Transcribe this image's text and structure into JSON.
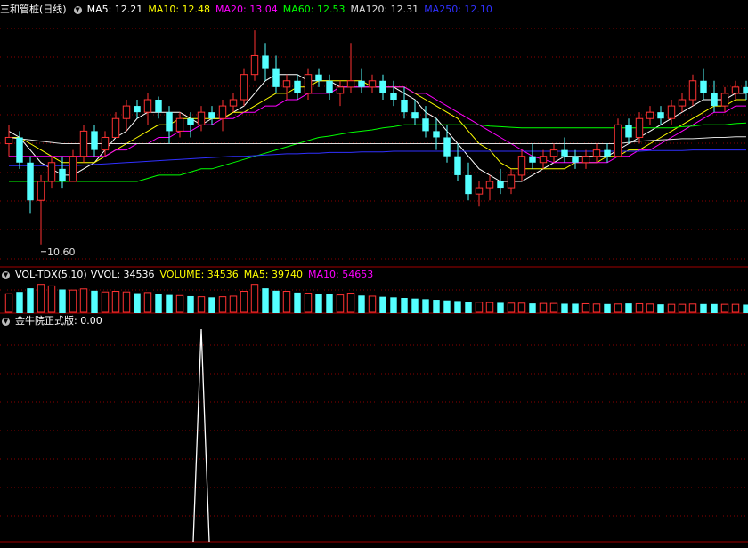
{
  "kline": {
    "title": "三和管桩(日线)",
    "ma_labels": [
      {
        "text": "MA5: 12.21",
        "color": "#ffffff"
      },
      {
        "text": "MA10: 12.48",
        "color": "#ffff00"
      },
      {
        "text": "MA20: 13.04",
        "color": "#ff00ff"
      },
      {
        "text": "MA60: 12.53",
        "color": "#00ff00"
      },
      {
        "text": "MA120: 12.31",
        "color": "#dddddd"
      },
      {
        "text": "MA250: 12.10",
        "color": "#3030ff"
      }
    ],
    "low_label": "10.60"
  },
  "volume": {
    "title": "VOL-TDX(5,10)",
    "labels": [
      {
        "text": "VVOL: 34536",
        "color": "#ffffff"
      },
      {
        "text": "VOLUME: 34536",
        "color": "#ffff00"
      },
      {
        "text": "MA5: 39740",
        "color": "#ffff00"
      },
      {
        "text": "MA10: 54653",
        "color": "#ff00ff"
      }
    ]
  },
  "indicator": {
    "title": "金牛院正式版",
    "value": ": 0.00"
  },
  "colors": {
    "up": "#ff3232",
    "down": "#54ffff",
    "grid": "#8b0000",
    "border": "#a00000"
  },
  "chart_data": [
    {
      "type": "candlestick",
      "title": "三和管桩(日线)",
      "ylim": [
        10.3,
        14.2
      ],
      "ohlc": [
        [
          12.2,
          12.5,
          12.0,
          12.3
        ],
        [
          12.3,
          12.4,
          11.8,
          11.9
        ],
        [
          11.9,
          12.0,
          11.1,
          11.3
        ],
        [
          11.3,
          11.7,
          10.6,
          11.6
        ],
        [
          11.6,
          12.0,
          11.5,
          11.9
        ],
        [
          11.8,
          12.0,
          11.5,
          11.6
        ],
        [
          11.6,
          12.1,
          11.6,
          12.0
        ],
        [
          12.0,
          12.5,
          11.9,
          12.4
        ],
        [
          12.4,
          12.5,
          12.0,
          12.1
        ],
        [
          12.1,
          12.4,
          12.0,
          12.3
        ],
        [
          12.3,
          12.7,
          12.3,
          12.6
        ],
        [
          12.6,
          12.9,
          12.4,
          12.8
        ],
        [
          12.8,
          12.9,
          12.6,
          12.7
        ],
        [
          12.7,
          13.0,
          12.5,
          12.9
        ],
        [
          12.9,
          12.95,
          12.6,
          12.7
        ],
        [
          12.7,
          12.8,
          12.2,
          12.4
        ],
        [
          12.4,
          12.7,
          12.3,
          12.6
        ],
        [
          12.6,
          12.7,
          12.3,
          12.5
        ],
        [
          12.5,
          12.8,
          12.4,
          12.7
        ],
        [
          12.7,
          12.8,
          12.5,
          12.6
        ],
        [
          12.6,
          12.9,
          12.4,
          12.8
        ],
        [
          12.8,
          13.0,
          12.7,
          12.9
        ],
        [
          12.9,
          13.4,
          12.8,
          13.3
        ],
        [
          13.3,
          14.0,
          13.2,
          13.6
        ],
        [
          13.6,
          13.8,
          13.2,
          13.4
        ],
        [
          13.4,
          13.6,
          13.0,
          13.1
        ],
        [
          13.1,
          13.3,
          12.9,
          13.2
        ],
        [
          13.2,
          13.3,
          12.9,
          13.0
        ],
        [
          13.0,
          13.4,
          12.9,
          13.3
        ],
        [
          13.3,
          13.4,
          13.1,
          13.2
        ],
        [
          13.2,
          13.3,
          12.9,
          13.0
        ],
        [
          13.0,
          13.2,
          12.8,
          13.1
        ],
        [
          13.1,
          13.8,
          13.0,
          13.2
        ],
        [
          13.2,
          13.4,
          13.0,
          13.1
        ],
        [
          13.1,
          13.3,
          13.0,
          13.2
        ],
        [
          13.2,
          13.3,
          12.9,
          13.0
        ],
        [
          13.0,
          13.2,
          12.8,
          12.9
        ],
        [
          12.9,
          13.1,
          12.6,
          12.7
        ],
        [
          12.7,
          12.9,
          12.5,
          12.6
        ],
        [
          12.6,
          12.8,
          12.3,
          12.4
        ],
        [
          12.4,
          12.6,
          12.1,
          12.3
        ],
        [
          12.3,
          12.5,
          11.9,
          12.0
        ],
        [
          12.0,
          12.2,
          11.6,
          11.7
        ],
        [
          11.7,
          11.9,
          11.3,
          11.4
        ],
        [
          11.4,
          11.6,
          11.2,
          11.5
        ],
        [
          11.5,
          11.7,
          11.3,
          11.6
        ],
        [
          11.6,
          11.8,
          11.4,
          11.5
        ],
        [
          11.5,
          11.8,
          11.4,
          11.7
        ],
        [
          11.7,
          12.1,
          11.6,
          12.0
        ],
        [
          12.0,
          12.2,
          11.8,
          11.9
        ],
        [
          11.9,
          12.1,
          11.8,
          12.0
        ],
        [
          12.0,
          12.2,
          11.9,
          12.1
        ],
        [
          12.1,
          12.3,
          11.9,
          12.0
        ],
        [
          12.0,
          12.1,
          11.8,
          11.9
        ],
        [
          11.9,
          12.1,
          11.8,
          12.0
        ],
        [
          12.0,
          12.2,
          11.9,
          12.1
        ],
        [
          12.1,
          12.2,
          11.9,
          12.0
        ],
        [
          12.0,
          12.6,
          12.0,
          12.5
        ],
        [
          12.5,
          12.6,
          12.2,
          12.3
        ],
        [
          12.3,
          12.7,
          12.2,
          12.6
        ],
        [
          12.6,
          12.8,
          12.5,
          12.7
        ],
        [
          12.7,
          12.8,
          12.5,
          12.6
        ],
        [
          12.6,
          12.9,
          12.5,
          12.8
        ],
        [
          12.8,
          13.0,
          12.7,
          12.9
        ],
        [
          12.9,
          13.3,
          12.8,
          13.2
        ],
        [
          13.2,
          13.4,
          12.9,
          13.0
        ],
        [
          13.0,
          13.2,
          12.7,
          12.8
        ],
        [
          12.8,
          13.1,
          12.7,
          13.0
        ],
        [
          13.0,
          13.2,
          12.9,
          13.1
        ],
        [
          13.1,
          13.2,
          12.9,
          13.0
        ]
      ],
      "ma": [
        {
          "name": "MA5",
          "color": "#ffffff",
          "values": [
            12.4,
            12.3,
            12.1,
            11.9,
            11.8,
            11.7,
            11.7,
            11.8,
            11.9,
            12.1,
            12.3,
            12.4,
            12.6,
            12.7,
            12.7,
            12.7,
            12.7,
            12.6,
            12.5,
            12.6,
            12.6,
            12.7,
            12.8,
            13.0,
            13.2,
            13.3,
            13.3,
            13.3,
            13.2,
            13.2,
            13.2,
            13.1,
            13.1,
            13.1,
            13.1,
            13.1,
            13.1,
            13.0,
            12.9,
            12.7,
            12.6,
            12.4,
            12.2,
            12.0,
            11.8,
            11.7,
            11.6,
            11.6,
            11.6,
            11.7,
            11.8,
            11.9,
            12.0,
            12.0,
            12.0,
            12.0,
            12.0,
            12.1,
            12.2,
            12.3,
            12.4,
            12.5,
            12.6,
            12.7,
            12.8,
            12.9,
            12.9,
            12.9,
            13.0,
            13.0
          ]
        },
        {
          "name": "MA10",
          "color": "#ffff00",
          "values": [
            12.3,
            12.3,
            12.2,
            12.1,
            12.0,
            11.9,
            11.9,
            11.9,
            11.9,
            12.0,
            12.1,
            12.2,
            12.3,
            12.4,
            12.5,
            12.5,
            12.6,
            12.6,
            12.6,
            12.6,
            12.6,
            12.7,
            12.7,
            12.8,
            12.9,
            13.0,
            13.0,
            13.1,
            13.1,
            13.2,
            13.2,
            13.2,
            13.2,
            13.2,
            13.1,
            13.1,
            13.1,
            13.1,
            13.0,
            12.9,
            12.8,
            12.7,
            12.6,
            12.4,
            12.2,
            12.1,
            11.9,
            11.8,
            11.8,
            11.8,
            11.8,
            11.8,
            11.8,
            11.9,
            11.9,
            11.9,
            12.0,
            12.0,
            12.1,
            12.1,
            12.2,
            12.3,
            12.4,
            12.5,
            12.6,
            12.7,
            12.8,
            12.8,
            12.9,
            12.9
          ]
        },
        {
          "name": "MA20",
          "color": "#ff00ff",
          "values": [
            12.0,
            12.0,
            12.0,
            12.0,
            12.0,
            12.0,
            12.0,
            12.0,
            12.0,
            12.0,
            12.1,
            12.1,
            12.2,
            12.2,
            12.3,
            12.3,
            12.4,
            12.4,
            12.5,
            12.5,
            12.6,
            12.6,
            12.7,
            12.7,
            12.8,
            12.8,
            12.9,
            12.9,
            13.0,
            13.0,
            13.0,
            13.1,
            13.1,
            13.1,
            13.1,
            13.1,
            13.1,
            13.1,
            13.0,
            13.0,
            12.9,
            12.8,
            12.7,
            12.6,
            12.5,
            12.4,
            12.3,
            12.2,
            12.1,
            12.0,
            11.95,
            11.9,
            11.9,
            11.9,
            11.9,
            11.9,
            11.9,
            12.0,
            12.0,
            12.1,
            12.1,
            12.2,
            12.3,
            12.4,
            12.5,
            12.6,
            12.7,
            12.7,
            12.8,
            12.8
          ]
        },
        {
          "name": "MA60",
          "color": "#00ff00",
          "values": [
            11.6,
            11.6,
            11.6,
            11.6,
            11.6,
            11.6,
            11.6,
            11.6,
            11.6,
            11.6,
            11.6,
            11.6,
            11.6,
            11.65,
            11.7,
            11.7,
            11.7,
            11.75,
            11.8,
            11.8,
            11.85,
            11.9,
            11.95,
            12.0,
            12.05,
            12.1,
            12.15,
            12.2,
            12.25,
            12.3,
            12.32,
            12.35,
            12.38,
            12.4,
            12.42,
            12.45,
            12.47,
            12.5,
            12.5,
            12.5,
            12.5,
            12.5,
            12.5,
            12.5,
            12.5,
            12.48,
            12.47,
            12.46,
            12.45,
            12.45,
            12.45,
            12.45,
            12.45,
            12.45,
            12.45,
            12.45,
            12.45,
            12.45,
            12.45,
            12.45,
            12.45,
            12.45,
            12.45,
            12.47,
            12.48,
            12.5,
            12.5,
            12.5,
            12.52,
            12.53
          ]
        },
        {
          "name": "MA120",
          "color": "#dddddd",
          "values": [
            12.3,
            12.28,
            12.26,
            12.24,
            12.22,
            12.2,
            12.2,
            12.2,
            12.2,
            12.2,
            12.2,
            12.2,
            12.2,
            12.2,
            12.2,
            12.2,
            12.2,
            12.2,
            12.2,
            12.2,
            12.2,
            12.2,
            12.2,
            12.2,
            12.2,
            12.2,
            12.2,
            12.2,
            12.2,
            12.2,
            12.2,
            12.2,
            12.2,
            12.2,
            12.2,
            12.2,
            12.2,
            12.2,
            12.2,
            12.2,
            12.2,
            12.2,
            12.2,
            12.2,
            12.2,
            12.2,
            12.2,
            12.2,
            12.2,
            12.2,
            12.2,
            12.2,
            12.2,
            12.2,
            12.2,
            12.2,
            12.2,
            12.2,
            12.22,
            12.24,
            12.25,
            12.26,
            12.27,
            12.28,
            12.28,
            12.29,
            12.3,
            12.3,
            12.31,
            12.31
          ]
        },
        {
          "name": "MA250",
          "color": "#3030ff",
          "values": [
            11.85,
            11.85,
            11.85,
            11.85,
            11.85,
            11.85,
            11.85,
            11.86,
            11.87,
            11.88,
            11.89,
            11.9,
            11.91,
            11.92,
            11.93,
            11.94,
            11.95,
            11.96,
            11.97,
            11.98,
            11.99,
            12.0,
            12.0,
            12.01,
            12.02,
            12.03,
            12.04,
            12.04,
            12.05,
            12.05,
            12.06,
            12.06,
            12.06,
            12.07,
            12.07,
            12.07,
            12.08,
            12.08,
            12.08,
            12.08,
            12.08,
            12.08,
            12.08,
            12.08,
            12.08,
            12.08,
            12.08,
            12.08,
            12.08,
            12.08,
            12.08,
            12.08,
            12.08,
            12.08,
            12.08,
            12.08,
            12.08,
            12.08,
            12.08,
            12.08,
            12.09,
            12.09,
            12.09,
            12.09,
            12.1,
            12.1,
            12.1,
            12.1,
            12.1,
            12.1
          ]
        }
      ]
    },
    {
      "type": "bar",
      "title": "VOL-TDX(5,10)",
      "values": [
        64,
        70,
        82,
        95,
        90,
        78,
        76,
        80,
        74,
        70,
        72,
        70,
        66,
        68,
        64,
        60,
        58,
        56,
        54,
        52,
        54,
        56,
        72,
        95,
        82,
        74,
        72,
        68,
        66,
        64,
        62,
        60,
        66,
        58,
        56,
        54,
        52,
        50,
        48,
        46,
        44,
        42,
        40,
        38,
        36,
        35,
        34,
        33,
        33,
        32,
        32,
        32,
        31,
        31,
        31,
        30,
        30,
        30,
        32,
        31,
        30,
        29,
        29,
        29,
        30,
        30,
        30,
        29,
        29,
        28
      ],
      "ylim": [
        0,
        100
      ]
    },
    {
      "type": "line",
      "title": "金牛院正式版",
      "values": [
        0,
        0,
        0,
        0,
        0,
        0,
        0,
        0,
        0,
        0,
        0,
        0,
        0,
        0,
        0,
        0,
        0,
        0,
        0,
        0,
        0,
        0,
        0,
        0,
        0,
        0,
        0,
        0,
        0,
        0,
        0,
        0,
        0,
        0,
        0,
        0,
        0,
        0,
        0,
        0,
        0,
        0,
        0,
        0,
        0,
        0,
        0,
        0,
        0,
        0,
        0,
        0,
        0,
        0,
        0,
        0,
        0,
        0,
        0,
        0,
        0,
        0,
        0,
        0,
        0,
        0,
        0,
        0,
        0,
        0,
        0
      ],
      "peak": {
        "index": 18,
        "value": 1
      },
      "ylim": [
        0,
        1
      ]
    }
  ]
}
